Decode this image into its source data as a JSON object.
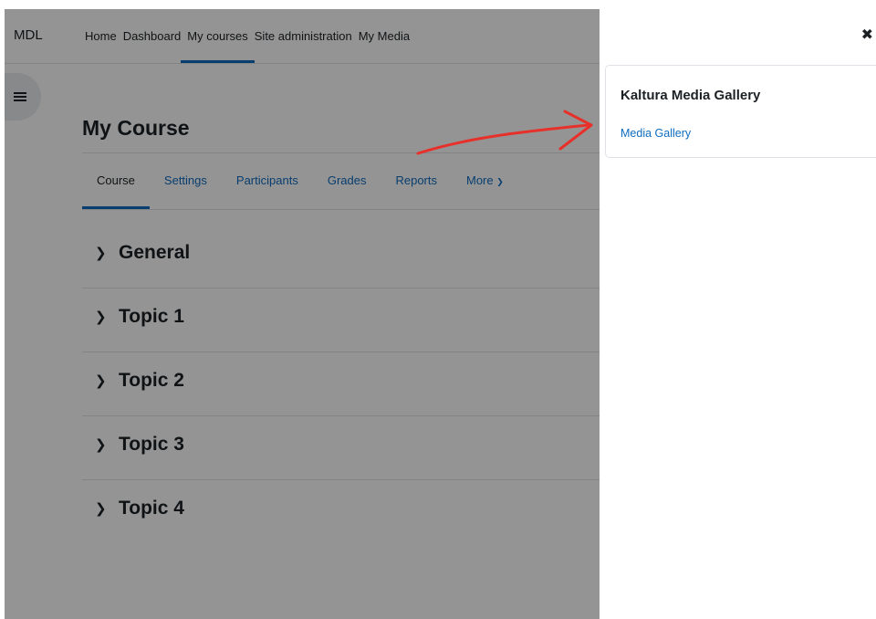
{
  "navbar": {
    "brand": "MDL",
    "items": [
      {
        "label": "Home"
      },
      {
        "label": "Dashboard"
      },
      {
        "label": "My courses"
      },
      {
        "label": "Site administration"
      },
      {
        "label": "My Media"
      }
    ],
    "active": "My courses"
  },
  "course": {
    "title": "My Course",
    "tabs": [
      {
        "label": "Course"
      },
      {
        "label": "Settings"
      },
      {
        "label": "Participants"
      },
      {
        "label": "Grades"
      },
      {
        "label": "Reports"
      },
      {
        "label": "More"
      }
    ],
    "sections": [
      {
        "name": "General"
      },
      {
        "name": "Topic 1"
      },
      {
        "name": "Topic 2"
      },
      {
        "name": "Topic 3"
      },
      {
        "name": "Topic 4"
      }
    ]
  },
  "drawer": {
    "close_icon": "✖",
    "block_title": "Kaltura Media Gallery",
    "block_link": "Media Gallery"
  },
  "icons": {
    "drawer_toggle": "list-icon",
    "chevron": "chevron-right-icon",
    "more_caret": "chevron-down-icon",
    "close": "close-icon"
  },
  "colors": {
    "link": "#0f6cbf",
    "arrow": "#e8302a",
    "overlay": "rgba(0,0,0,0.42)"
  }
}
